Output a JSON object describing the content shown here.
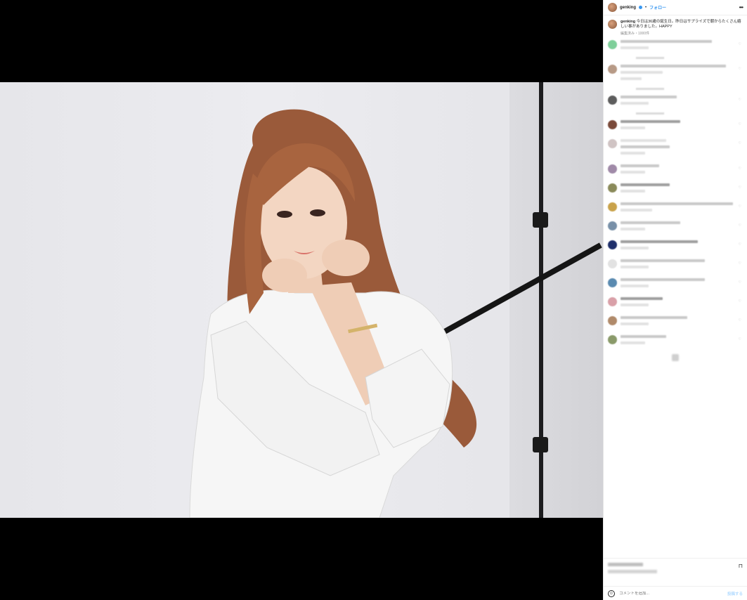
{
  "post": {
    "username": "genking",
    "separator": "•",
    "follow_label": "フォロー",
    "more_label": "•••"
  },
  "caption": {
    "username": "genking",
    "text": "今日は36歳の誕生日。昨日はサプライズで朝からたくさん嬉しい事がありました。HAPPY",
    "meta": "編集済み・1000件"
  },
  "comments_count_visible": 16,
  "add_comment": {
    "placeholder": "コメントを追加...",
    "post_label": "投稿する"
  },
  "colors": {
    "link": "#3897f0",
    "text": "#262626",
    "muted": "#8e8e8e"
  },
  "icons": [
    "avatar",
    "verified-icon",
    "more-icon",
    "heart-icon",
    "bookmark-icon",
    "smile-icon"
  ]
}
